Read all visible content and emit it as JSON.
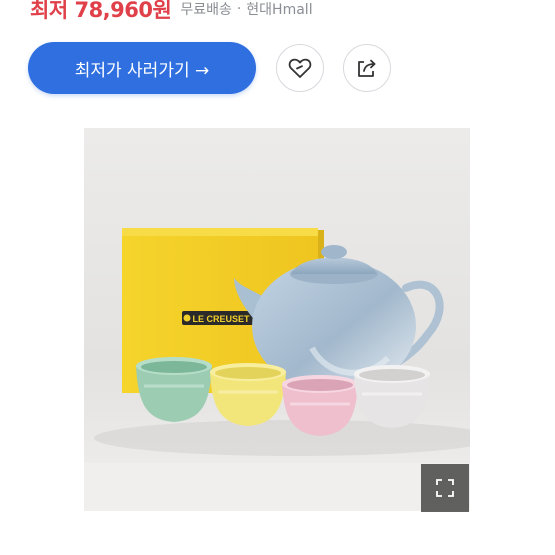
{
  "price": {
    "label": "최저 78,960원",
    "shipping": "무료배송",
    "separator": "·",
    "seller": "현대Hmall"
  },
  "actions": {
    "buy_label": "최저가 사러가기 →",
    "wishlist_icon": "heart-icon",
    "share_icon": "share-icon"
  },
  "product_image": {
    "brand_text": "LE CREUSET",
    "expand_icon": "expand-icon"
  },
  "colors": {
    "accent": "#2f6fe0",
    "price": "#e0404a",
    "box": "#f2d02a",
    "teapot": "#9fb5c9"
  }
}
